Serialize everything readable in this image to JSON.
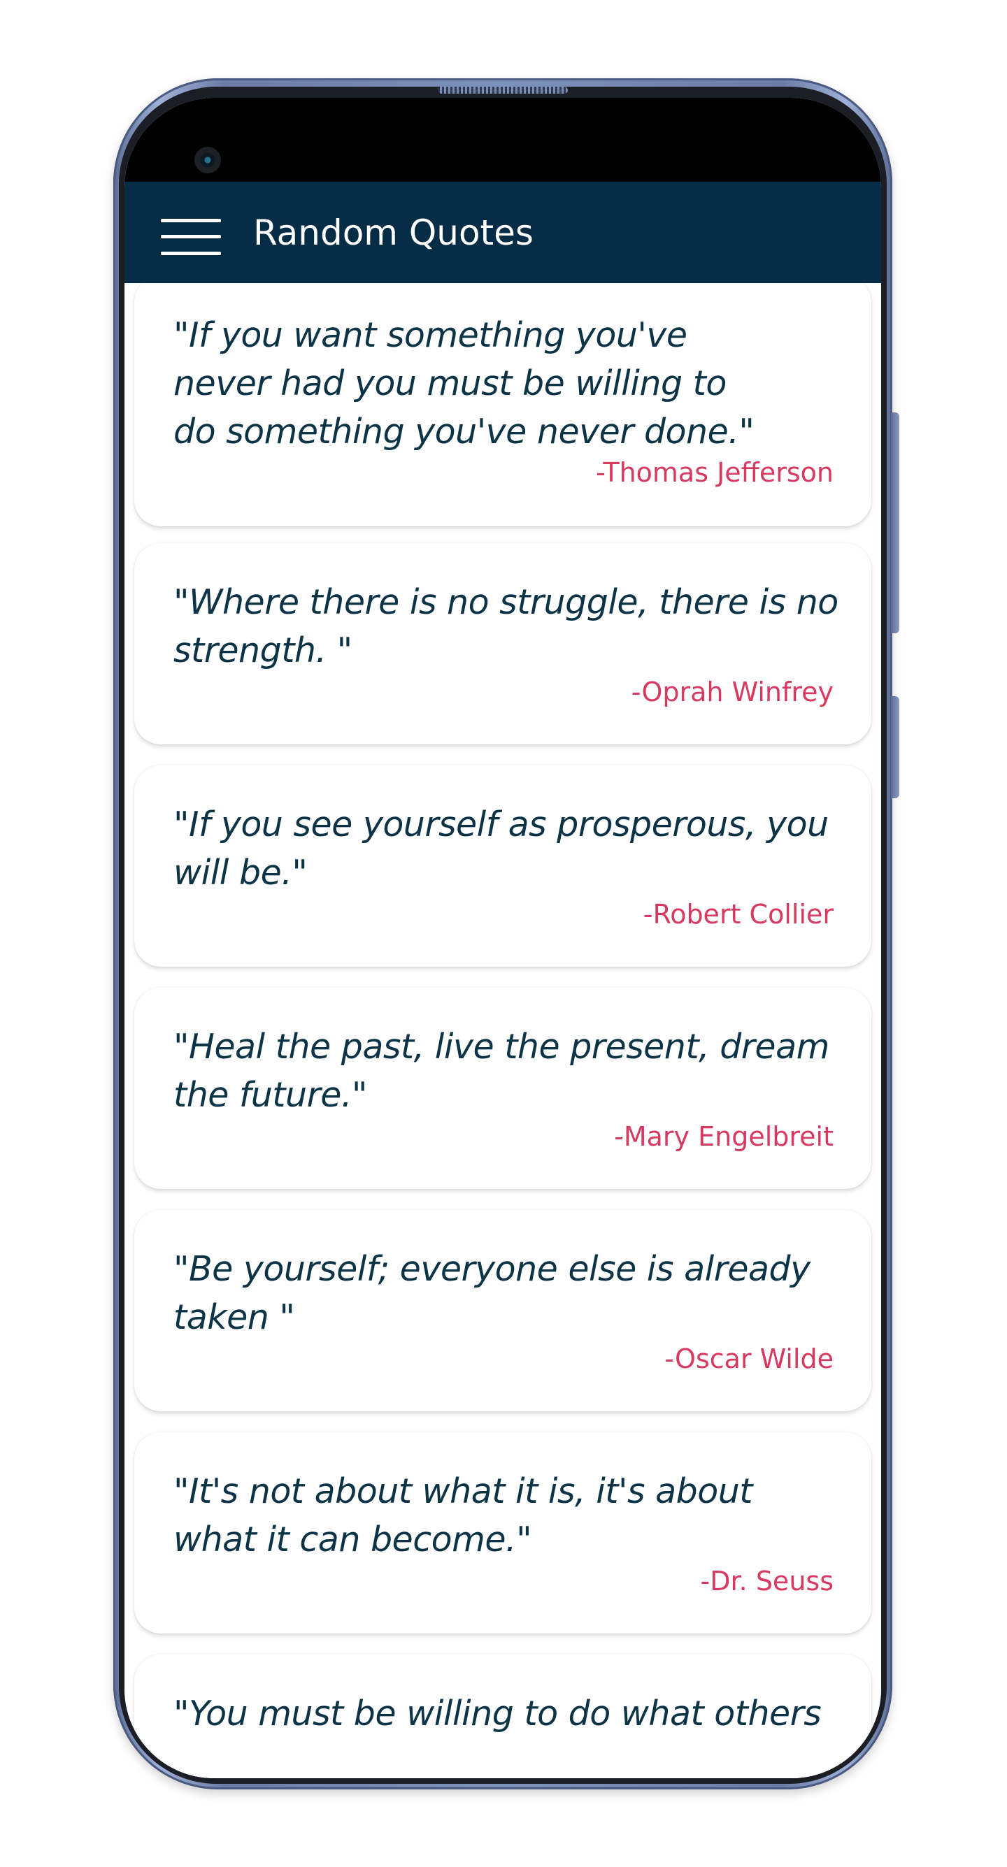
{
  "app": {
    "title": "Random Quotes"
  },
  "icons": {
    "menu": "hamburger-menu-icon",
    "camera": "front-camera"
  },
  "colors": {
    "app_bar": "#062d45",
    "quote_text": "#0d3346",
    "author_text": "#d63a61",
    "card_background": "#ffffff"
  },
  "quotes": [
    {
      "text": "\"If you want something you've never had you must be willing to do something you've never done.\"",
      "author": "-Thomas Jefferson"
    },
    {
      "text": "\"Where there is no struggle, there is no strength. \"",
      "author": "-Oprah Winfrey"
    },
    {
      "text": "\"If you see yourself as prosperous, you will be.\"",
      "author": "-Robert Collier"
    },
    {
      "text": "\"Heal the past, live the present, dream the future.\"",
      "author": "-Mary Engelbreit"
    },
    {
      "text": "\"Be yourself; everyone else is already taken \"",
      "author": "-Oscar Wilde"
    },
    {
      "text": "\"It's not about what it is, it's about what it can become.\"",
      "author": "-Dr. Seuss"
    },
    {
      "text": "\"You must be willing to do what others",
      "author": ""
    }
  ]
}
